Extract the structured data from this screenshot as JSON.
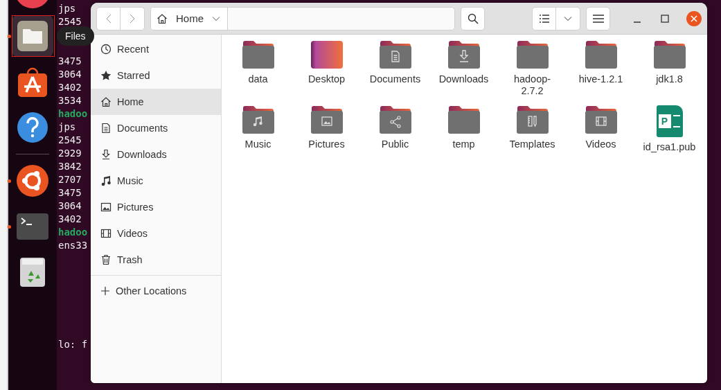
{
  "dock": {
    "items": [
      {
        "kind": "browser",
        "running": false,
        "selected": false
      },
      {
        "kind": "files",
        "running": true,
        "selected": true
      },
      {
        "kind": "store",
        "running": false,
        "selected": false
      },
      {
        "kind": "help",
        "running": false,
        "selected": false
      },
      {
        "kind": "separator"
      },
      {
        "kind": "ubuntu",
        "running": true,
        "selected": false
      },
      {
        "kind": "terminal",
        "running": true,
        "selected": false
      },
      {
        "kind": "trash",
        "running": false,
        "selected": false
      }
    ],
    "tooltip": "Files"
  },
  "terminal": {
    "lines": [
      {
        "text": "jps",
        "kind": "plain"
      },
      {
        "text": "2545",
        "kind": "plain"
      },
      {
        "text": "3475",
        "kind": "plain"
      },
      {
        "text": "3064",
        "kind": "plain"
      },
      {
        "text": "3402",
        "kind": "plain"
      },
      {
        "text": "3534",
        "kind": "plain"
      },
      {
        "text": "hadoo",
        "kind": "prompt"
      },
      {
        "text": "jps",
        "kind": "plain"
      },
      {
        "text": "2545",
        "kind": "plain"
      },
      {
        "text": "2929",
        "kind": "plain"
      },
      {
        "text": "3842",
        "kind": "plain"
      },
      {
        "text": "2707",
        "kind": "plain"
      },
      {
        "text": "3475",
        "kind": "plain"
      },
      {
        "text": "3064",
        "kind": "plain"
      },
      {
        "text": "3402",
        "kind": "plain"
      },
      {
        "text": "hadoo",
        "kind": "prompt"
      },
      {
        "text": "ens33",
        "kind": "plain"
      }
    ],
    "lower_lines": [
      "lo: f"
    ]
  },
  "window": {
    "path": "Home",
    "sidebar": [
      {
        "label": "Recent",
        "kind": "recent",
        "selected": false
      },
      {
        "label": "Starred",
        "kind": "starred",
        "selected": false
      },
      {
        "label": "Home",
        "kind": "home",
        "selected": true
      },
      {
        "label": "Documents",
        "kind": "documents",
        "selected": false
      },
      {
        "label": "Downloads",
        "kind": "downloads",
        "selected": false
      },
      {
        "label": "Music",
        "kind": "music",
        "selected": false
      },
      {
        "label": "Pictures",
        "kind": "pictures",
        "selected": false
      },
      {
        "label": "Videos",
        "kind": "videos",
        "selected": false
      },
      {
        "label": "Trash",
        "kind": "trash",
        "selected": false
      }
    ],
    "other_locations": "Other Locations",
    "files": [
      {
        "name": "data",
        "kind": "folder"
      },
      {
        "name": "Desktop",
        "kind": "desktop"
      },
      {
        "name": "Documents",
        "kind": "documents"
      },
      {
        "name": "Downloads",
        "kind": "downloads"
      },
      {
        "name": "hadoop-\n2.7.2",
        "kind": "folder"
      },
      {
        "name": "hive-1.2.1",
        "kind": "folder"
      },
      {
        "name": "jdk1.8",
        "kind": "folder"
      },
      {
        "name": "Music",
        "kind": "music"
      },
      {
        "name": "Pictures",
        "kind": "pictures"
      },
      {
        "name": "Public",
        "kind": "public"
      },
      {
        "name": "temp",
        "kind": "folder"
      },
      {
        "name": "Templates",
        "kind": "templates"
      },
      {
        "name": "Videos",
        "kind": "videos"
      },
      {
        "name": "id_rsa1.pub",
        "kind": "publisher",
        "badge": "P"
      }
    ]
  }
}
